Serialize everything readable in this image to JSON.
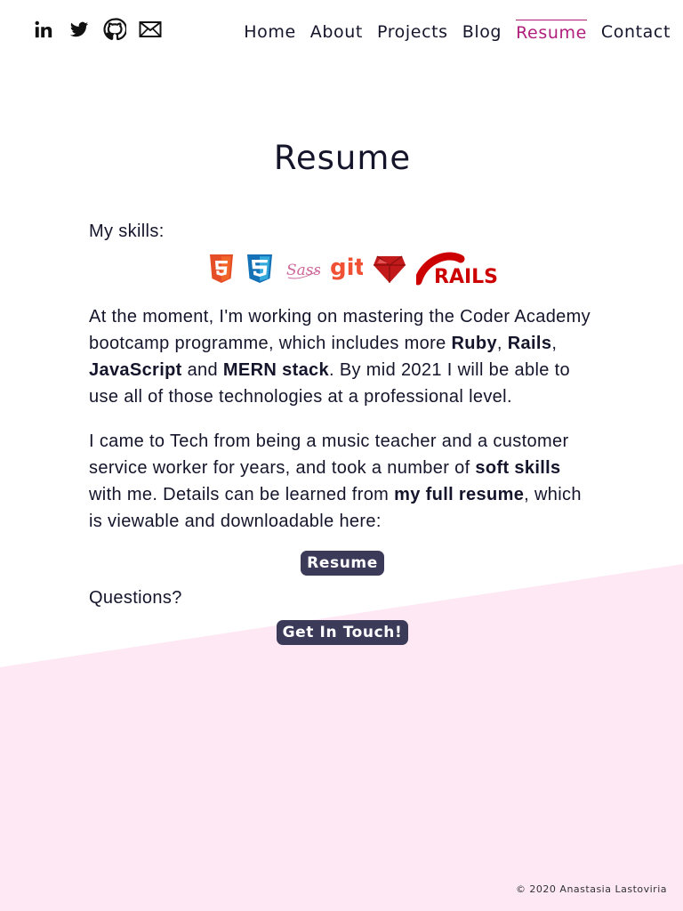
{
  "colors": {
    "accent": "#b01e7c",
    "button_bg": "#3b3a59",
    "pink_background": "#fde8f3",
    "text": "#14142b"
  },
  "header": {
    "socials": [
      {
        "icon": "linkedin-icon",
        "label": "LinkedIn"
      },
      {
        "icon": "twitter-icon",
        "label": "Twitter"
      },
      {
        "icon": "github-icon",
        "label": "GitHub"
      },
      {
        "icon": "mail-icon",
        "label": "Email"
      }
    ],
    "nav": [
      {
        "label": "Home"
      },
      {
        "label": "About"
      },
      {
        "label": "Projects"
      },
      {
        "label": "Blog"
      },
      {
        "label": "Resume",
        "active": true
      },
      {
        "label": "Contact"
      }
    ]
  },
  "main": {
    "title": "Resume",
    "skills_label": "My skills:",
    "skill_icons": [
      "html5-icon",
      "css3-icon",
      "sass-icon",
      "git-icon",
      "ruby-icon",
      "rails-icon"
    ],
    "p1": {
      "t1": "At the moment, I'm working on mastering the Coder Academy bootcamp programme, which includes more ",
      "b1": "Ruby",
      "t2": ", ",
      "b2": "Rails",
      "t3": ", ",
      "b3": "JavaScript",
      "t4": " and ",
      "b4": "MERN stack",
      "t5": ". By mid 2021 I will be able to use all of those technologies at a professional level."
    },
    "p2": {
      "t1": "I came to Tech from being a music teacher and a customer service worker for years, and took a number of ",
      "b1": "soft skills",
      "t2": " with me. Details can be learned from ",
      "b2": "my full resume",
      "t3": ", which is viewable and downloadable here:"
    },
    "resume_button": "Resume",
    "questions": "Questions?",
    "contact_button": "Get In Touch!"
  },
  "footer": {
    "copyright": "© 2020 Anastasia Lastoviria"
  }
}
